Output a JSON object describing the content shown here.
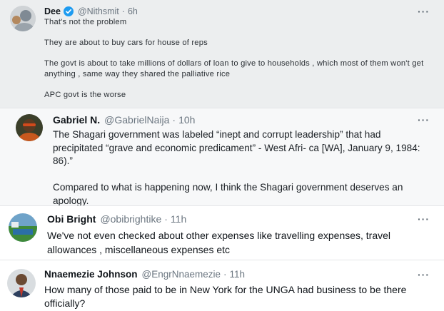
{
  "tweets": [
    {
      "name": "Dee",
      "verified": true,
      "handle": "@Nithsmit",
      "time": "6h",
      "paragraphs": [
        "That's not the problem",
        "They are about to buy cars for house of reps",
        "The govt is about to take millions of dollars of loan to give to households , which most of them won't get anything , same way they shared the palliative rice",
        "APC govt is the worse"
      ]
    },
    {
      "name": "Gabriel N.",
      "handle": "@GabrielNaija",
      "time": "10h",
      "paragraphs": [
        "The Shagari government was labeled “inept and corrupt leadership” that had precipitated “grave and economic predicament” - West Afri- ca [WA], January 9, 1984: 86).”",
        "Compared to what is happening now, I think the Shagari government deserves an apology."
      ]
    },
    {
      "name": "Obi Bright",
      "handle": "@obibrightike",
      "time": "11h",
      "paragraphs": [
        "We've not even checked about other expenses like travelling expenses, travel allowances , miscellaneous expenses etc"
      ]
    },
    {
      "name": "Nnaemezie Johnson",
      "handle": "@EngrNnaemezie",
      "time": "11h",
      "paragraphs": [
        "How many of those paid to be in New York for the UNGA had business to be there officially?"
      ]
    }
  ],
  "ui": {
    "more_glyph": "···",
    "separator": "·"
  },
  "colors": {
    "verified_badge": "#1d9bf0",
    "secondary_text": "#6b7680"
  }
}
